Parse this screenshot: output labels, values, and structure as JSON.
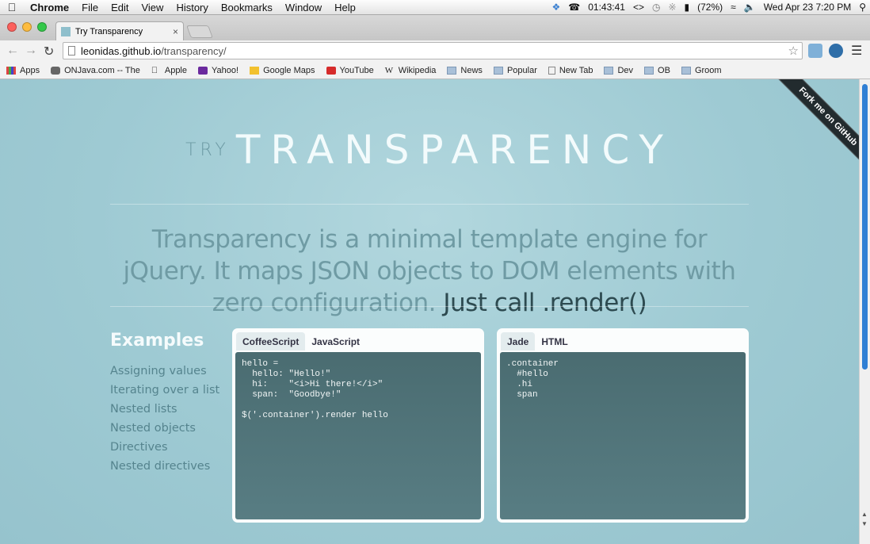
{
  "menubar": {
    "app": "Chrome",
    "items": [
      "File",
      "Edit",
      "View",
      "History",
      "Bookmarks",
      "Window",
      "Help"
    ],
    "clock": "01:43:41",
    "battery": "(72%)",
    "datetime": "Wed Apr 23  7:20 PM"
  },
  "tab": {
    "title": "Try Transparency",
    "close": "×"
  },
  "address": {
    "host": "leonidas.github.io",
    "path": "/transparency/"
  },
  "bookmarks": [
    "Apps",
    "ONJava.com -- The",
    "Apple",
    "Yahoo!",
    "Google Maps",
    "YouTube",
    "Wikipedia",
    "News",
    "Popular",
    "New Tab",
    "Dev",
    "OB",
    "Groom"
  ],
  "page": {
    "try": "TRY",
    "title": "TRANSPARENCY",
    "tagline": "Transparency is a minimal template engine for jQuery. It maps JSON objects to DOM elements with zero configuration.",
    "tagline_call": "Just call .render()",
    "examples_title": "Examples",
    "examples": [
      "Assigning values",
      "Iterating over a list",
      "Nested lists",
      "Nested objects",
      "Directives",
      "Nested directives"
    ],
    "ribbon": "Fork me on GitHub",
    "left_panel": {
      "tabs": [
        "CoffeeScript",
        "JavaScript"
      ],
      "code": "hello =\n  hello: \"Hello!\"\n  hi:    \"<i>Hi there!</i>\"\n  span:  \"Goodbye!\"\n\n$('.container').render hello"
    },
    "right_panel": {
      "tabs": [
        "Jade",
        "HTML"
      ],
      "code": ".container\n  #hello\n  .hi\n  span"
    }
  },
  "colors": {
    "page_bg": "#9fc9d2",
    "code_bg": "#4a6c71",
    "accent_scroll": "#2f7fd4"
  }
}
